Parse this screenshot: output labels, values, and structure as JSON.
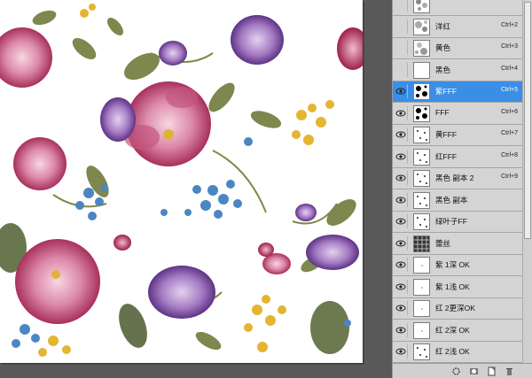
{
  "channels": [
    {
      "name": "",
      "shortcut": "",
      "visible": false,
      "selected": false,
      "thumb": "green"
    },
    {
      "name": "洋红",
      "shortcut": "Ctrl+2",
      "visible": false,
      "selected": false,
      "thumb": "magenta"
    },
    {
      "name": "黄色",
      "shortcut": "Ctrl+3",
      "visible": false,
      "selected": false,
      "thumb": "yellow"
    },
    {
      "name": "黑色",
      "shortcut": "Ctrl+4",
      "visible": false,
      "selected": false,
      "thumb": "white"
    },
    {
      "name": "紫FFF",
      "shortcut": "Ctrl+5",
      "visible": true,
      "selected": true,
      "thumb": "spots"
    },
    {
      "name": "FFF",
      "shortcut": "Ctrl+6",
      "visible": true,
      "selected": false,
      "thumb": "spots"
    },
    {
      "name": "黄FFF",
      "shortcut": "Ctrl+7",
      "visible": true,
      "selected": false,
      "thumb": "dots"
    },
    {
      "name": "红FFF",
      "shortcut": "Ctrl+8",
      "visible": true,
      "selected": false,
      "thumb": "dots"
    },
    {
      "name": "黑色 副本 2",
      "shortcut": "Ctrl+9",
      "visible": true,
      "selected": false,
      "thumb": "dots"
    },
    {
      "name": "黑色 副本",
      "shortcut": "",
      "visible": true,
      "selected": false,
      "thumb": "dots"
    },
    {
      "name": "绿叶子FF",
      "shortcut": "",
      "visible": true,
      "selected": false,
      "thumb": "dots"
    },
    {
      "name": "蕾丝",
      "shortcut": "",
      "visible": true,
      "selected": false,
      "thumb": "lace"
    },
    {
      "name": "紫 1深 OK",
      "shortcut": "",
      "visible": true,
      "selected": false,
      "thumb": "blank"
    },
    {
      "name": "紫 1浅 OK",
      "shortcut": "",
      "visible": true,
      "selected": false,
      "thumb": "blank"
    },
    {
      "name": "红 2更深OK",
      "shortcut": "",
      "visible": true,
      "selected": false,
      "thumb": "blank"
    },
    {
      "name": "红 2深 OK",
      "shortcut": "",
      "visible": true,
      "selected": false,
      "thumb": "blank"
    },
    {
      "name": "红 2浅 OK",
      "shortcut": "",
      "visible": true,
      "selected": false,
      "thumb": "dots"
    },
    {
      "name": "蓝 3浅OK",
      "shortcut": "",
      "visible": true,
      "selected": false,
      "thumb": "blank"
    }
  ],
  "bottom_buttons": [
    "load-selection-icon",
    "save-selection-icon",
    "new-channel-icon",
    "delete-channel-icon"
  ],
  "colors": {
    "selected_row": "#3a8ee6",
    "panel_bg": "#d4d4d4",
    "workspace_bg": "#595959"
  }
}
